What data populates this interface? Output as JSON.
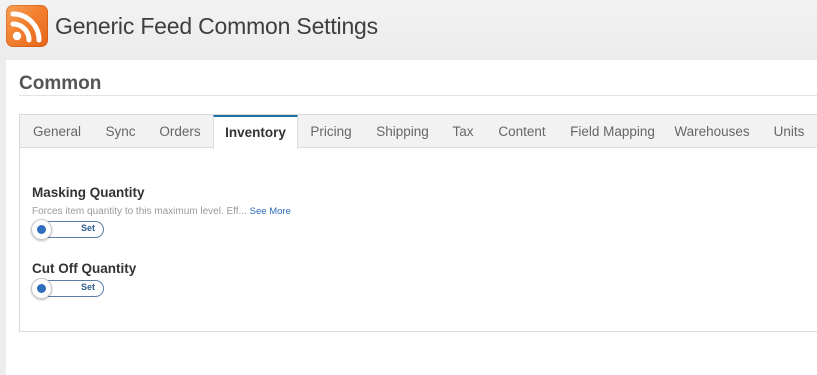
{
  "header": {
    "title": "Generic Feed Common Settings",
    "icon": "rss-icon",
    "icon_color": "#f2802f"
  },
  "section": {
    "title": "Common"
  },
  "tabs": [
    {
      "label": "General",
      "active": false
    },
    {
      "label": "Sync",
      "active": false
    },
    {
      "label": "Orders",
      "active": false
    },
    {
      "label": "Inventory",
      "active": true
    },
    {
      "label": "Pricing",
      "active": false
    },
    {
      "label": "Shipping",
      "active": false
    },
    {
      "label": "Tax",
      "active": false
    },
    {
      "label": "Content",
      "active": false
    },
    {
      "label": "Field Mapping",
      "active": false
    },
    {
      "label": "Warehouses",
      "active": false
    },
    {
      "label": "Units",
      "active": false
    }
  ],
  "fields": {
    "masking_quantity": {
      "label": "Masking Quantity",
      "description": "Forces item quantity to this maximum level. Eff...",
      "see_more": "See More",
      "toggle_label": "Set"
    },
    "cut_off_quantity": {
      "label": "Cut Off Quantity",
      "toggle_label": "Set"
    }
  },
  "colors": {
    "accent": "#1b73a5",
    "toggle_knob": "#2f6dbd",
    "link": "#2a6db3"
  }
}
